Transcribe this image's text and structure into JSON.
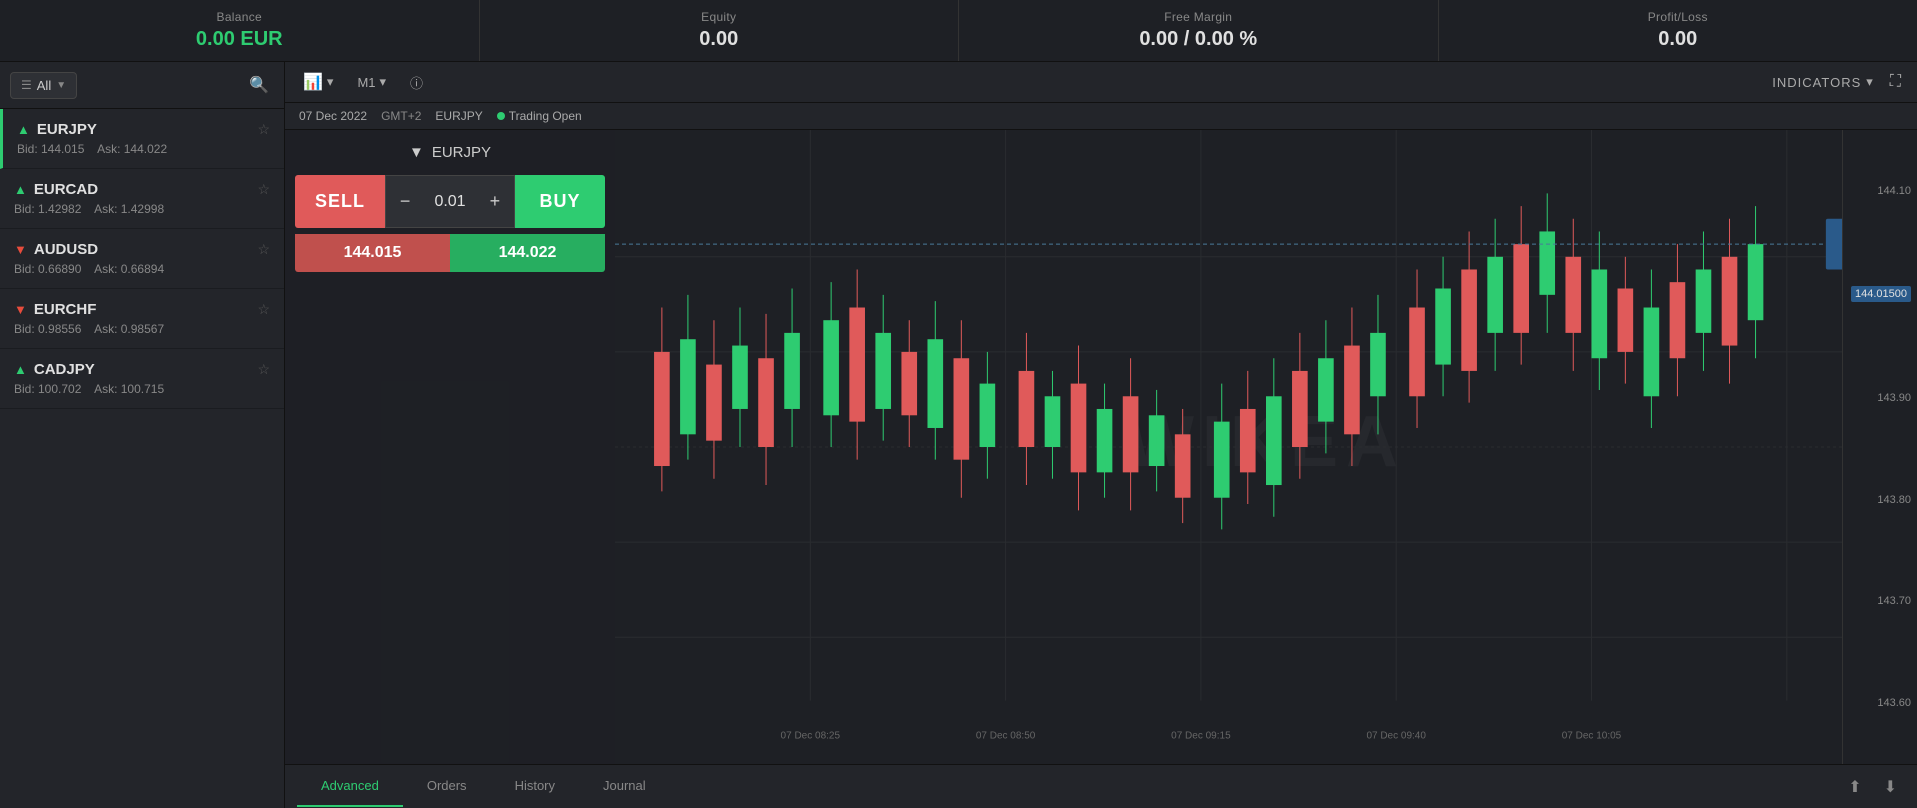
{
  "header": {
    "balance_label": "Balance",
    "balance_value": "0.00 EUR",
    "equity_label": "Equity",
    "equity_value": "0.00",
    "free_margin_label": "Free Margin",
    "free_margin_value": "0.00 / 0.00 %",
    "profit_loss_label": "Profit/Loss",
    "profit_loss_value": "0.00"
  },
  "sidebar": {
    "filter_label": "All",
    "instruments": [
      {
        "symbol": "EURJPY",
        "trend": "up",
        "bid_label": "Bid:",
        "bid": "144.015",
        "ask_label": "Ask:",
        "ask": "144.022"
      },
      {
        "symbol": "EURCAD",
        "trend": "up",
        "bid_label": "Bid:",
        "bid": "1.42982",
        "ask_label": "Ask:",
        "ask": "1.42998"
      },
      {
        "symbol": "AUDUSD",
        "trend": "down",
        "bid_label": "Bid:",
        "bid": "0.66890",
        "ask_label": "Ask:",
        "ask": "0.66894"
      },
      {
        "symbol": "EURCHF",
        "trend": "down",
        "bid_label": "Bid:",
        "bid": "0.98556",
        "ask_label": "Ask:",
        "ask": "0.98567"
      },
      {
        "symbol": "CADJPY",
        "trend": "up",
        "bid_label": "Bid:",
        "bid": "100.702",
        "ask_label": "Ask:",
        "ask": "100.715"
      }
    ]
  },
  "chart": {
    "timeframe": "M1",
    "indicators_label": "INDICATORS",
    "date": "07 Dec 2022",
    "gmt": "GMT+2",
    "symbol": "EURJPY",
    "trading_status": "Trading Open",
    "current_price": "144.01500",
    "price_levels": [
      "144.10",
      "143.90",
      "143.80",
      "143.70",
      "143.60"
    ],
    "time_labels": [
      "07 Dec 08:25",
      "07 Dec 08:50",
      "07 Dec 09:15",
      "07 Dec 09:40",
      "07 Dec 10:05"
    ],
    "trade_symbol": "EURJPY",
    "sell_label": "SELL",
    "buy_label": "BUY",
    "lot_value": "0.01",
    "sell_price": "144.015",
    "buy_price": "144.022"
  },
  "tabs": {
    "items": [
      {
        "id": "advanced",
        "label": "Advanced",
        "active": true
      },
      {
        "id": "orders",
        "label": "Orders",
        "active": false
      },
      {
        "id": "history",
        "label": "History",
        "active": false
      },
      {
        "id": "journal",
        "label": "Journal",
        "active": false
      }
    ]
  }
}
